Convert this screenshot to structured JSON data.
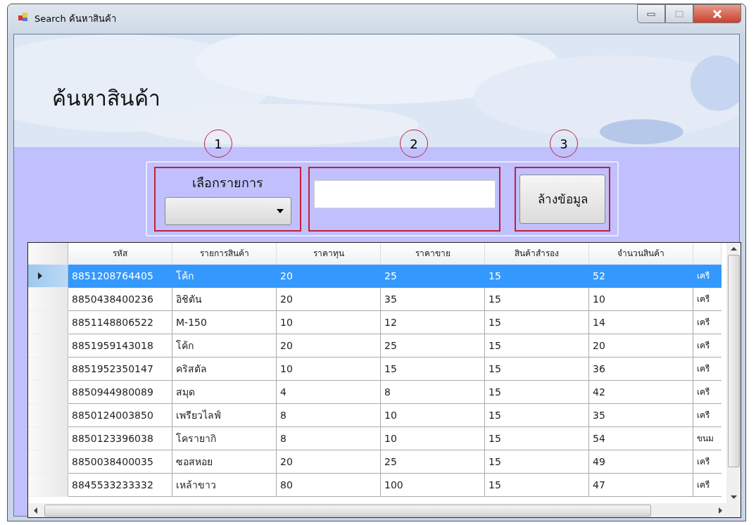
{
  "window": {
    "title": "Search ค้นหาสินค้า"
  },
  "heading": "ค้นหาสินค้า",
  "markers": [
    "1",
    "2",
    "3"
  ],
  "category": {
    "label": "เลือกรายการ"
  },
  "clear_button": "ล้างข้อมูล",
  "table": {
    "columns": [
      "รหัส",
      "รายการสินค้า",
      "ราคาทุน",
      "ราคาขาย",
      "สินค้าสำรอง",
      "จำนวนสินค้า"
    ],
    "rows": [
      {
        "selected": true,
        "cells": [
          "8851208764405",
          "โค้ก",
          "20",
          "25",
          "15",
          "52",
          "เครื"
        ]
      },
      {
        "selected": false,
        "cells": [
          "8850438400236",
          "อิชิตัน",
          "20",
          "35",
          "15",
          "10",
          "เครื"
        ]
      },
      {
        "selected": false,
        "cells": [
          "8851148806522",
          "M-150",
          "10",
          "12",
          "15",
          "14",
          "เครื"
        ]
      },
      {
        "selected": false,
        "cells": [
          "8851959143018",
          "โค้ก",
          "20",
          "25",
          "15",
          "20",
          "เครื"
        ]
      },
      {
        "selected": false,
        "cells": [
          "8851952350147",
          "คริสตัล",
          "10",
          "15",
          "15",
          "36",
          "เครื"
        ]
      },
      {
        "selected": false,
        "cells": [
          "8850944980089",
          "สมุด",
          "4",
          "8",
          "15",
          "42",
          "เครื"
        ]
      },
      {
        "selected": false,
        "cells": [
          "8850124003850",
          "เพรียวไลฟ์",
          "8",
          "10",
          "15",
          "35",
          "เครื"
        ]
      },
      {
        "selected": false,
        "cells": [
          "8850123396038",
          "โครายากิ",
          "8",
          "10",
          "15",
          "54",
          "ขนม"
        ]
      },
      {
        "selected": false,
        "cells": [
          "8850038400035",
          "ซอสหอย",
          "20",
          "25",
          "15",
          "49",
          "เครื"
        ]
      },
      {
        "selected": false,
        "cells": [
          "8845533233332",
          "เหล้าขาว",
          "80",
          "100",
          "15",
          "47",
          "เครื"
        ]
      }
    ]
  }
}
